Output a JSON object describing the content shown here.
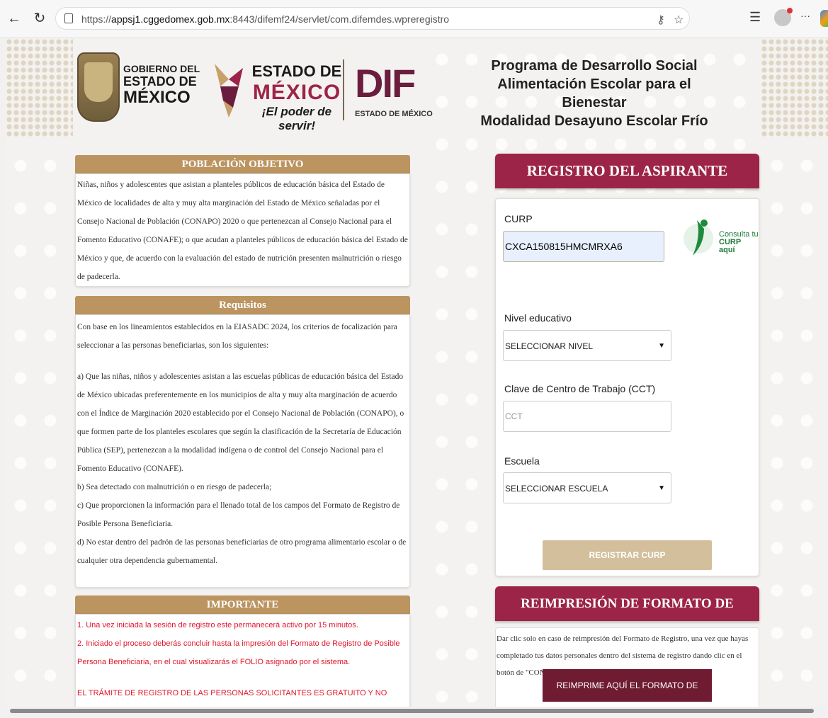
{
  "browser": {
    "url_prefix": "https://",
    "url_host": "appsj1.cggedomex.gob.mx",
    "url_rest": ":8443/difemf24/servlet/com.difemdes.wpreregistro",
    "menu_label": "···"
  },
  "header": {
    "gobierno_line1": "GOBIERNO DEL",
    "gobierno_line2": "ESTADO DE",
    "gobierno_line3": "MÉXICO",
    "edomex_line1": "ESTADO DE",
    "edomex_line2": "MÉXICO",
    "edomex_line3": "¡El poder de servir!",
    "dif": "DIF",
    "dif_sub": "ESTADO DE MÉXICO",
    "program_line1": "Programa de Desarrollo Social",
    "program_line2": "Alimentación Escolar para el Bienestar",
    "program_line3": "Modalidad Desayuno Escolar Frío"
  },
  "poblacion": {
    "title": "POBLACIÓN OBJETIVO",
    "text": "Niñas, niños y adolescentes que asistan a planteles públicos de educación básica del Estado de México de localidades de alta y muy alta marginación del Estado de México señaladas por el Consejo Nacional de Población (CONAPO) 2020 o que pertenezcan al Consejo Nacional para el Fomento Educativo (CONAFE); o que acudan a planteles públicos de educación básica del Estado de México y que, de acuerdo con la evaluación del estado de nutrición presenten malnutrición o riesgo de padecerla."
  },
  "requisitos": {
    "title": "Requisitos",
    "intro": "Con base en los lineamientos establecidos en la EIASADC 2024, los criterios de focalización para seleccionar a las personas beneficiarias, son los siguientes:",
    "a": "a) Que las niñas, niños y adolescentes asistan a las escuelas públicas de educación básica del Estado de México ubicadas preferentemente en los municipios de alta y muy alta marginación de acuerdo con el Índice de Marginación 2020 establecido por el Consejo Nacional de Población (CONAPO), o que formen parte de los planteles escolares que según la clasificación de la Secretaría de Educación Pública (SEP), pertenezcan a la modalidad indígena o de control del Consejo Nacional para el Fomento Educativo (CONAFE).",
    "b": "b) Sea detectado con malnutrición o en riesgo de padecerla;",
    "c": "c) Que proporcionen la información para el llenado total de los campos del Formato de Registro de Posible Persona Beneficiaria.",
    "d": "d) No estar dentro del padrón de las personas beneficiarias de otro programa alimentario escolar o de cualquier otra dependencia gubernamental."
  },
  "importante": {
    "title": "IMPORTANTE",
    "p1": "1. Una vez iniciada la sesión de registro este permanecerá activo por 15 minutos.",
    "p2": "2. Iniciado el proceso deberás concluir hasta la impresión del Formato de Registro de Posible Persona Beneficiaria, en el cual visualizarás el FOLIO asignado por el sistema.",
    "p3": "EL TRÁMITE DE REGISTRO DE LAS PERSONAS SOLICITANTES ES GRATUITO Y NO SIGNIFICA NECESARIAMENTE SU"
  },
  "registro": {
    "title": "REGISTRO DEL ASPIRANTE",
    "curp_label": "CURP",
    "curp_value": "CXCA150815HMCMRXA6",
    "curp_link_line1": "Consulta tu",
    "curp_link_line2": "CURP aquí",
    "nivel_label": "Nivel educativo",
    "nivel_selected": "SELECCIONAR NIVEL",
    "cct_label": "Clave de Centro de Trabajo (CCT)",
    "cct_placeholder": "CCT",
    "escuela_label": "Escuela",
    "escuela_selected": "SELECCIONAR ESCUELA",
    "submit_label": "REGISTRAR CURP"
  },
  "reimpresion": {
    "title": "REIMPRESIÓN DE FORMATO DE REGISTRO",
    "text": "Dar clic solo en caso de reimpresión del Formato de Registro, una vez que hayas completado tus datos personales dentro del sistema de registro dando clic en el botón de \"CONTINUAR\"",
    "button_label": "REIMPRIME AQUÍ EL FORMATO DE REGISTRO"
  },
  "colors": {
    "gold": "#bb9460",
    "guinda": "#9d2449",
    "button_disabled": "#d4bf9c",
    "alert_red": "#e0162b"
  }
}
